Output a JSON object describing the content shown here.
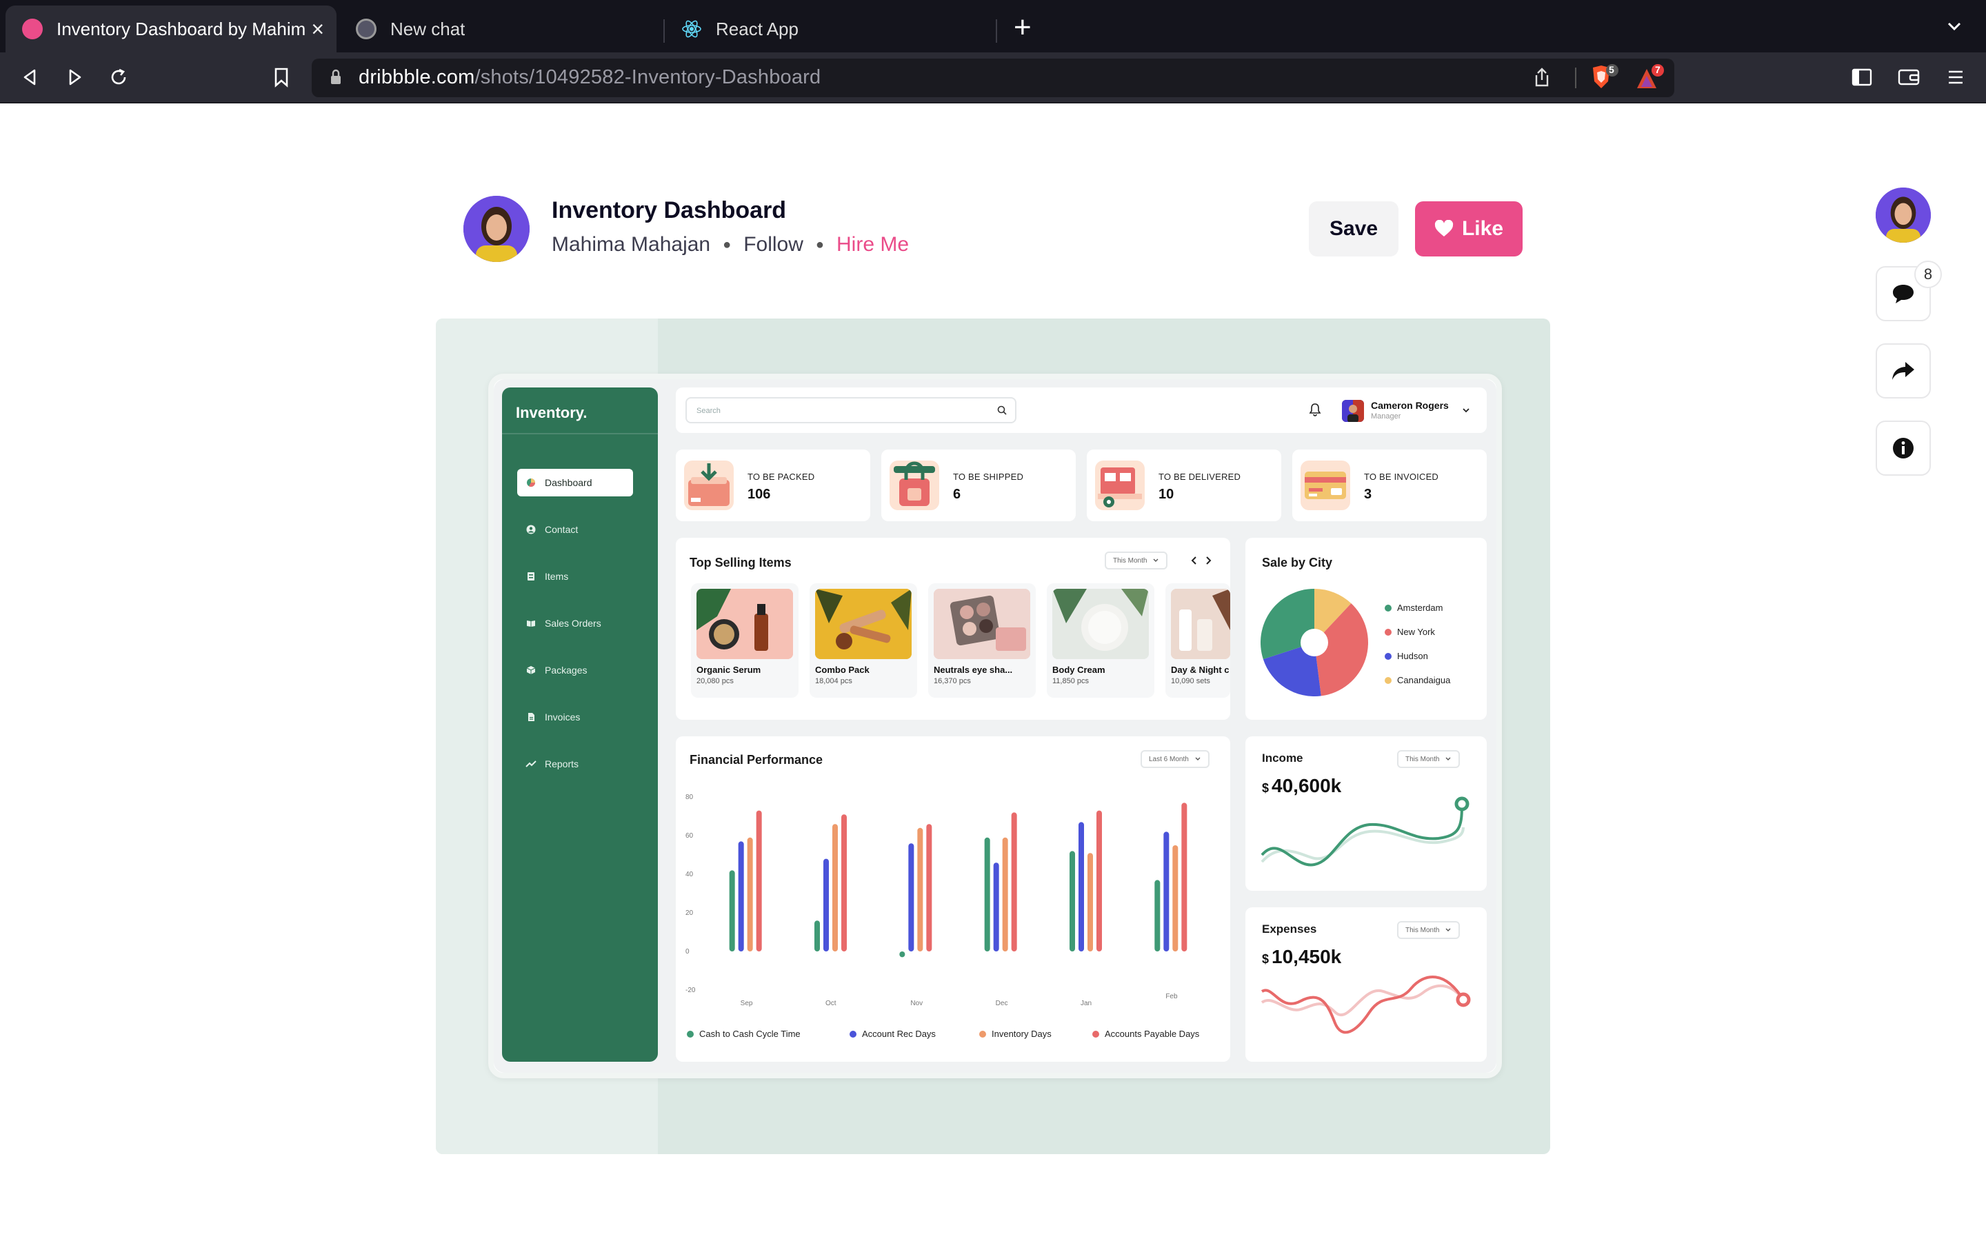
{
  "browser": {
    "tabs": [
      {
        "title": "Inventory Dashboard by Mahim",
        "active": true
      },
      {
        "title": "New chat",
        "active": false
      },
      {
        "title": "React App",
        "active": false
      }
    ],
    "url_host": "dribbble.com",
    "url_path": "/shots/10492582-Inventory-Dashboard",
    "shield_count": "5",
    "alert_count": "7"
  },
  "shot": {
    "title": "Inventory Dashboard",
    "author": "Mahima Mahajan",
    "follow_label": "Follow",
    "hire_label": "Hire Me",
    "save_label": "Save",
    "like_label": "Like",
    "comment_count": "8"
  },
  "dashboard": {
    "brand": "Inventory.",
    "search_placeholder": "Search",
    "user": {
      "name": "Cameron Rogers",
      "role": "Manager"
    },
    "nav": [
      "Dashboard",
      "Contact",
      "Items",
      "Sales Orders",
      "Packages",
      "Invoices",
      "Reports"
    ],
    "stats": [
      {
        "label": "TO BE PACKED",
        "value": "106"
      },
      {
        "label": "TO BE SHIPPED",
        "value": "6"
      },
      {
        "label": "TO BE DELIVERED",
        "value": "10"
      },
      {
        "label": "TO BE INVOICED",
        "value": "3"
      }
    ],
    "top_selling": {
      "title": "Top Selling Items",
      "filter": "This Month",
      "items": [
        {
          "name": "Organic Serum",
          "qty": "20,080 pcs"
        },
        {
          "name": "Combo Pack",
          "qty": "18,004 pcs"
        },
        {
          "name": "Neutrals eye sha...",
          "qty": "16,370 pcs"
        },
        {
          "name": "Body Cream",
          "qty": "11,850 pcs"
        },
        {
          "name": "Day & Night c",
          "qty": "10,090 sets"
        }
      ]
    },
    "sale_by_city": {
      "title": "Sale by City",
      "legend": [
        "Amsterdam",
        "New York",
        "Hudson",
        "Canandaigua"
      ]
    },
    "financial": {
      "title": "Financial Performance",
      "filter": "Last 6 Month"
    },
    "income": {
      "title": "Income",
      "filter": "This Month",
      "currency": "$",
      "amount": "40,600k"
    },
    "expenses": {
      "title": "Expenses",
      "filter": "This Month",
      "currency": "$",
      "amount": "10,450k"
    }
  },
  "colors": {
    "sidebar": "#2e7456",
    "green": "#3f9a75",
    "blue": "#4a53d9",
    "orange": "#ee9a6a",
    "red": "#e86a6a",
    "yellow": "#f2c46d",
    "pink": "#ea4c89"
  },
  "chart_data": [
    {
      "type": "bar",
      "categories": [
        "Sep",
        "Oct",
        "Nov",
        "Dec",
        "Jan",
        "Feb"
      ],
      "series": [
        {
          "name": "Cash to Cash Cycle Time",
          "values": [
            42,
            16,
            -3,
            59,
            52,
            37
          ]
        },
        {
          "name": "Account Rec Days",
          "values": [
            57,
            48,
            56,
            46,
            67,
            62
          ]
        },
        {
          "name": "Inventory Days",
          "values": [
            59,
            66,
            64,
            59,
            51,
            55
          ]
        },
        {
          "name": "Accounts Payable Days",
          "values": [
            73,
            71,
            66,
            72,
            73,
            77
          ]
        }
      ],
      "yticks": [
        80,
        60,
        40,
        20,
        0,
        -20
      ],
      "ylim": [
        -20,
        80
      ]
    },
    {
      "type": "pie",
      "labels": [
        "Amsterdam",
        "New York",
        "Hudson",
        "Canandaigua"
      ],
      "values": [
        30,
        36,
        22,
        12
      ]
    }
  ]
}
